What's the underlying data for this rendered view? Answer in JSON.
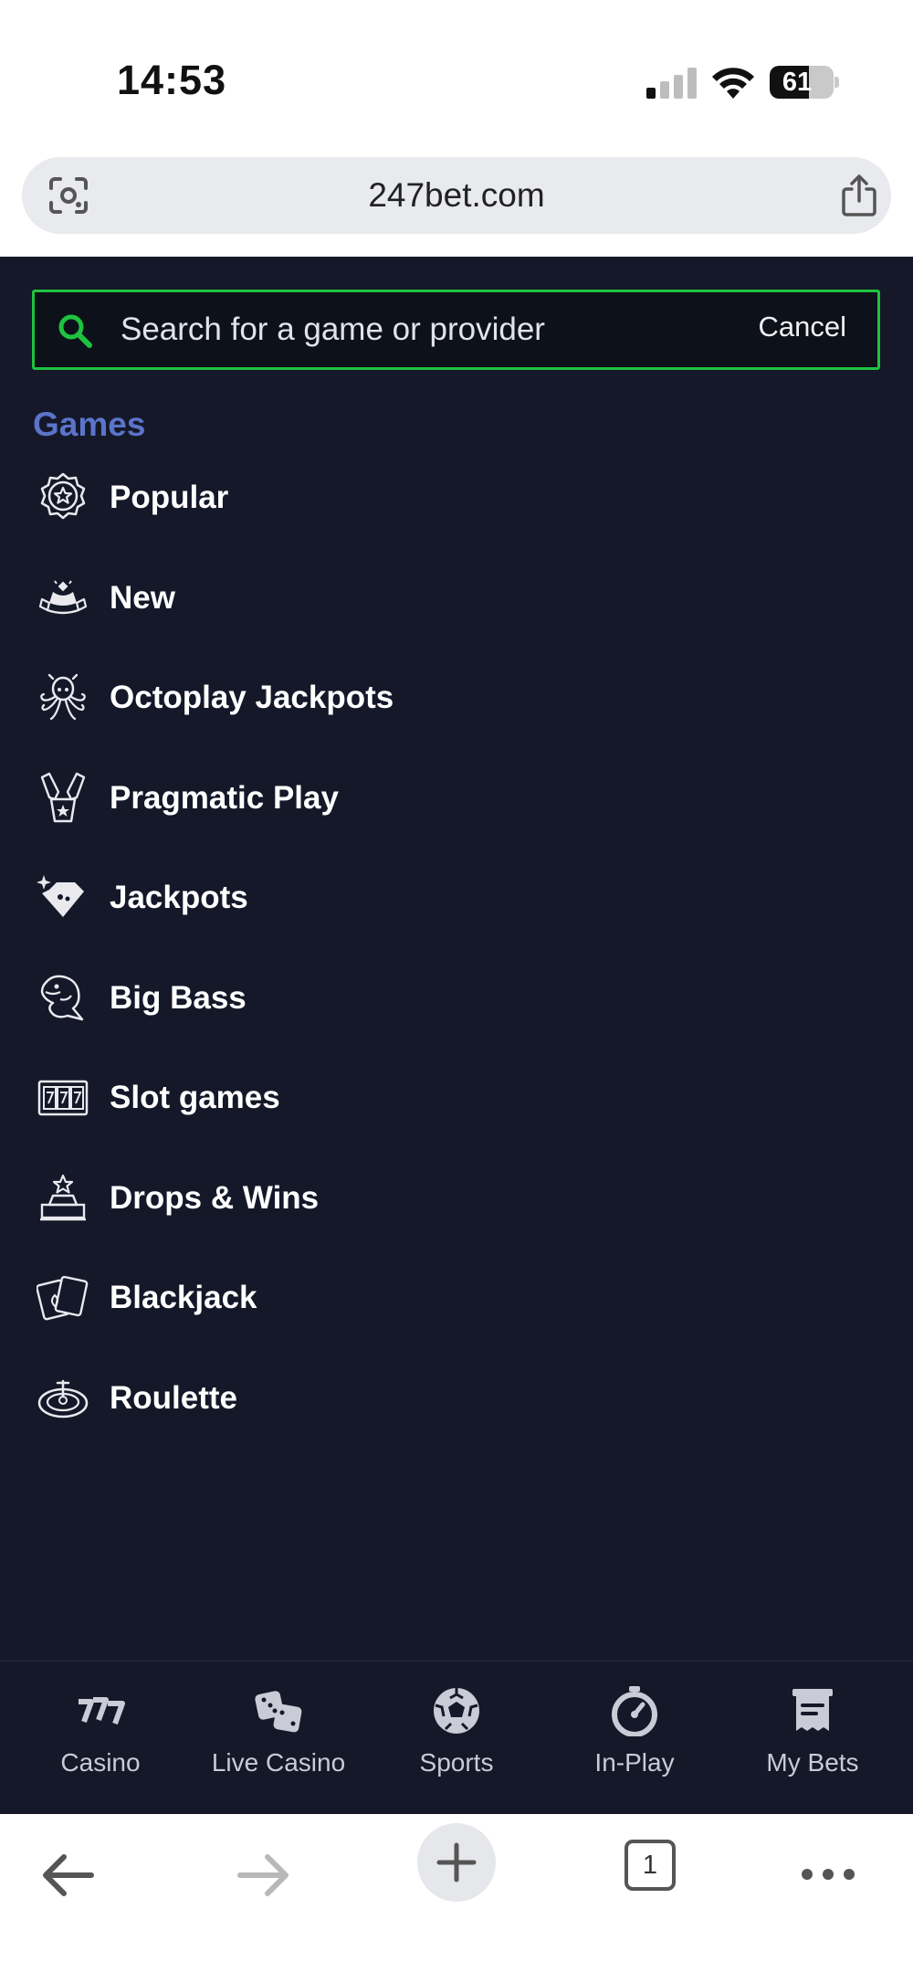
{
  "status_bar": {
    "time": "14:53",
    "battery": "61",
    "battery_level_pct": 61,
    "icons": [
      "signal-icon",
      "wifi-icon",
      "battery-icon"
    ]
  },
  "browser": {
    "url": "247bet.com",
    "tabs_count": "1",
    "icons": [
      "lens-icon",
      "share-icon",
      "back-arrow-icon",
      "forward-arrow-icon",
      "new-tab-plus-icon",
      "tabs-icon",
      "more-icon"
    ]
  },
  "search": {
    "placeholder": "Search for a game or provider",
    "value": "",
    "cancel_label": "Cancel"
  },
  "games": {
    "title": "Games",
    "items": [
      {
        "label": "Popular",
        "icon": "badge-star-icon"
      },
      {
        "label": "New",
        "icon": "new-podium-icon"
      },
      {
        "label": "Octoplay Jackpots",
        "icon": "octopus-icon"
      },
      {
        "label": "Pragmatic Play",
        "icon": "champagne-icon"
      },
      {
        "label": "Jackpots",
        "icon": "diamond-icon"
      },
      {
        "label": "Big Bass",
        "icon": "fish-icon"
      },
      {
        "label": "Slot games",
        "icon": "slot-machine-icon"
      },
      {
        "label": "Drops & Wins",
        "icon": "star-podium-icon"
      },
      {
        "label": "Blackjack",
        "icon": "cards-icon"
      },
      {
        "label": "Roulette",
        "icon": "roulette-icon"
      }
    ]
  },
  "site_nav": [
    {
      "label": "Casino",
      "icon": "casino-777-icon"
    },
    {
      "label": "Live Casino",
      "icon": "dice-icon"
    },
    {
      "label": "Sports",
      "icon": "football-icon"
    },
    {
      "label": "In-Play",
      "icon": "stopwatch-icon"
    },
    {
      "label": "My Bets",
      "icon": "bet-slip-icon"
    }
  ],
  "colors": {
    "background": "#141829",
    "accent_green": "#1fc23f",
    "section_title": "#5b74c9"
  }
}
